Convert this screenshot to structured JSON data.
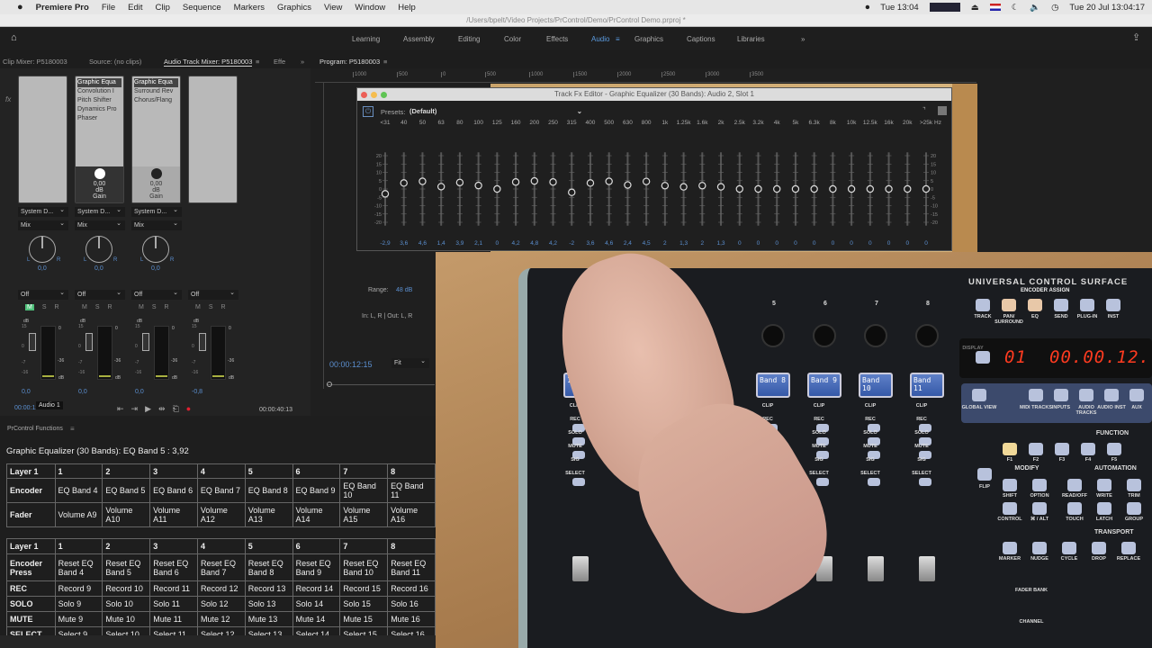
{
  "menubar": {
    "apple": "",
    "app": "Premiere Pro",
    "items": [
      "File",
      "Edit",
      "Clip",
      "Sequence",
      "Markers",
      "Graphics",
      "View",
      "Window",
      "Help"
    ],
    "clock_short": "Tue 13:04",
    "clock": "Tue 20 Jul  13:04:17"
  },
  "path": "/Users/bpelt/Video Projects/PrControl/Demo/PrControl Demo.prproj *",
  "workspaces": {
    "items": [
      "Learning",
      "Assembly",
      "Editing",
      "Color",
      "Effects",
      "Audio",
      "Graphics",
      "Captions",
      "Libraries"
    ],
    "active": "Audio",
    "more": "»"
  },
  "panel_tabs": {
    "clip_mixer": "Clip Mixer: P5180003",
    "source": "Source: (no clips)",
    "audio_mixer": "Audio Track Mixer: P5180003",
    "effects": "Effe",
    "more": "»",
    "program": "Program: P5180003"
  },
  "mixer": {
    "channels": [
      {
        "fx": [],
        "output": "System D...",
        "mode": "Mix",
        "pan": "0,0",
        "auto": "Off",
        "volume": "0,0",
        "mute_active": true
      },
      {
        "fx": [
          "Graphic Equa",
          "Convolution I",
          "Pitch Shifter",
          "Dynamics Pro",
          "Phaser"
        ],
        "gain": "0,00",
        "gain_unit": "dB",
        "gain_label": "Gain",
        "output": "System D...",
        "mode": "Mix",
        "pan": "0,0",
        "auto": "Off",
        "volume": "0,0",
        "mute_active": false
      },
      {
        "fx": [
          "Graphic Equa",
          "Surround Rev",
          "Chorus/Flang"
        ],
        "gain": "0,00",
        "gain_unit": "dB",
        "gain_label": "Gain",
        "output": "System D...",
        "mode": "Mix",
        "pan": "0,0",
        "auto": "Off",
        "volume": "0,0",
        "mute_active": false
      },
      {
        "fx": [],
        "auto": "Off",
        "volume": "-0,8",
        "mute_active": false
      }
    ],
    "msr": [
      "M",
      "S",
      "R"
    ],
    "pan_l": "L",
    "pan_r": "R",
    "scale": {
      "db": "dB",
      "v15": "15",
      "v0": "0",
      "vm7": "-7",
      "vm16": "-16",
      "m0": "0",
      "m36": "-36"
    },
    "track_tooltip": "Audio 1",
    "timecode_left": "00:00:12:15",
    "timecode_right": "00:00:40:13"
  },
  "program": {
    "ruler": [
      "1000",
      "500",
      "0",
      "500",
      "1000",
      "1500",
      "2000",
      "2500",
      "3000",
      "3500"
    ],
    "timecode": "00:00:12:15",
    "zoom": "Fit",
    "range_label": "Range:",
    "range_value": "48 dB",
    "io": "In: L, R | Out: L, R"
  },
  "eq": {
    "title": "Track Fx Editor - Graphic Equalizer (30 Bands): Audio 2, Slot 1",
    "presets_label": "Presets:",
    "preset": "(Default)",
    "unit": "Hz",
    "scale": [
      "20",
      "15",
      "10",
      "5",
      "0",
      "-5",
      "-10",
      "-15",
      "-20"
    ],
    "bands": [
      "<31",
      "40",
      "50",
      "63",
      "80",
      "100",
      "125",
      "160",
      "200",
      "250",
      "315",
      "400",
      "500",
      "630",
      "800",
      "1k",
      "1.25k",
      "1.6k",
      "2k",
      "2.5k",
      "3.2k",
      "4k",
      "5k",
      "6.3k",
      "8k",
      "10k",
      "12.5k",
      "16k",
      "20k",
      ">25k"
    ],
    "values": [
      -2.9,
      3.6,
      4.6,
      1.4,
      3.9,
      2.1,
      0,
      4.2,
      4.8,
      4.2,
      -2,
      3.6,
      4.6,
      2.4,
      4.5,
      2,
      1.3,
      2,
      1.3,
      0,
      0,
      0,
      0,
      0,
      0,
      0,
      0,
      0,
      0,
      0
    ],
    "value_labels": [
      "-2,9",
      "3,6",
      "4,6",
      "1,4",
      "3,9",
      "2,1",
      "0",
      "4,2",
      "4,8",
      "4,2",
      "-2",
      "3,6",
      "4,6",
      "2,4",
      "4,5",
      "2",
      "1,3",
      "2",
      "1,3",
      "0",
      "0",
      "0",
      "0",
      "0",
      "0",
      "0",
      "0",
      "0",
      "0",
      "0"
    ],
    "value_color": "#5b8fd0"
  },
  "hardware": {
    "brand": "UNIVERSAL CONTROL SURFACE",
    "encoder_assign": "ENCODER ASSIGN",
    "assign_buttons": [
      "TRACK",
      "PAN/ SURROUND",
      "EQ",
      "SEND",
      "PLUG-IN",
      "INST"
    ],
    "strips": [
      "1.40",
      "Band 8",
      "Band 9",
      "Band 10",
      "Band 11"
    ],
    "channel_numbers": [
      "1",
      "5",
      "6",
      "7",
      "8"
    ],
    "display_label": "DISPLAY",
    "track_display": "01",
    "time_display": "00.00.12.",
    "view_buttons": [
      "GLOBAL VIEW",
      "MIDI TRACKS",
      "INPUTS",
      "AUDIO TRACKS",
      "AUDIO INST",
      "AUX"
    ],
    "function": "FUNCTION",
    "f_buttons": [
      "F1",
      "F2",
      "F3",
      "F4",
      "F5"
    ],
    "modify": "MODIFY",
    "modify_buttons": [
      "SHIFT",
      "OPTION",
      "CONTROL",
      "⌘ / ALT"
    ],
    "automation": "AUTOMATION",
    "auto_buttons": [
      "READ/OFF",
      "WRITE",
      "TRIM",
      "TOUCH",
      "LATCH",
      "GROUP"
    ],
    "transport": "TRANSPORT",
    "transport_buttons": [
      "MARKER",
      "NUDGE",
      "CYCLE",
      "DROP",
      "REPLACE"
    ],
    "flip": "FLIP",
    "strip_buttons": [
      "CLIP",
      "REC",
      "SOLO",
      "MUTE",
      "SIG",
      "SELECT"
    ],
    "fader_bank": "FADER BANK",
    "channel": "CHANNEL",
    "led_color": "#ff3b20"
  },
  "functions": {
    "panel_title": "PrControl Functions",
    "status": "Graphic Equalizer (30 Bands): EQ Band 5 : 3,92",
    "table1": [
      [
        "Layer 1",
        "1",
        "2",
        "3",
        "4",
        "5",
        "6",
        "7",
        "8"
      ],
      [
        "Encoder",
        "EQ Band 4",
        "EQ Band 5",
        "EQ Band 6",
        "EQ Band 7",
        "EQ Band 8",
        "EQ Band 9",
        "EQ Band 10",
        "EQ Band 11"
      ],
      [
        "Fader",
        "Volume A9",
        "Volume A10",
        "Volume A11",
        "Volume A12",
        "Volume A13",
        "Volume A14",
        "Volume A15",
        "Volume A16"
      ]
    ],
    "table2": [
      [
        "Layer 1",
        "1",
        "2",
        "3",
        "4",
        "5",
        "6",
        "7",
        "8"
      ],
      [
        "Encoder Press",
        "Reset EQ Band 4",
        "Reset EQ Band 5",
        "Reset EQ Band 6",
        "Reset EQ Band 7",
        "Reset EQ Band 8",
        "Reset EQ Band 9",
        "Reset EQ Band 10",
        "Reset EQ Band 11"
      ],
      [
        "REC",
        "Record 9",
        "Record 10",
        "Record 11",
        "Record 12",
        "Record 13",
        "Record 14",
        "Record 15",
        "Record 16"
      ],
      [
        "SOLO",
        "Solo 9",
        "Solo 10",
        "Solo 11",
        "Solo 12",
        "Solo 13",
        "Solo 14",
        "Solo 15",
        "Solo 16"
      ],
      [
        "MUTE",
        "Mute 9",
        "Mute 10",
        "Mute 11",
        "Mute 12",
        "Mute 13",
        "Mute 14",
        "Mute 15",
        "Mute 16"
      ],
      [
        "SELECT",
        "Select 9",
        "Select 10",
        "Select 11",
        "Select 12",
        "Select 13",
        "Select 14",
        "Select 15",
        "Select 16"
      ]
    ]
  }
}
